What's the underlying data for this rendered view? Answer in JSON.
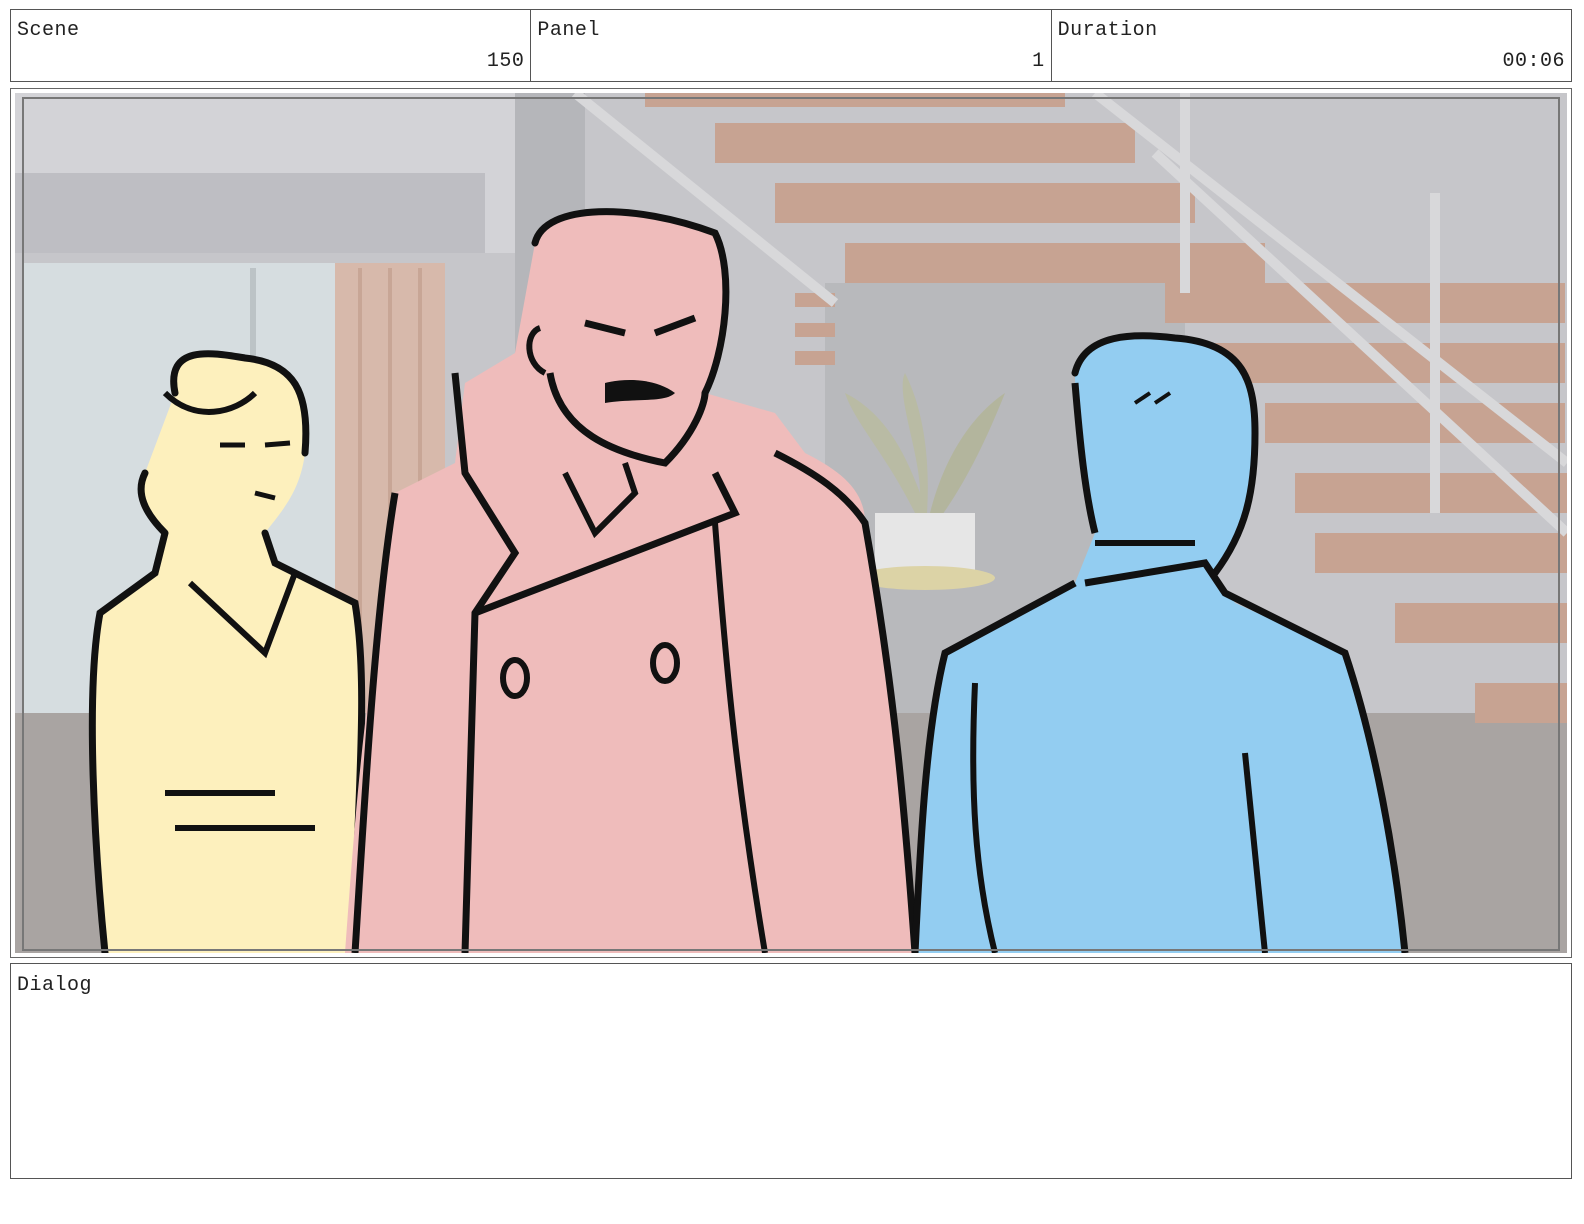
{
  "header": {
    "scene": {
      "label": "Scene",
      "value": "150"
    },
    "panel": {
      "label": "Panel",
      "value": "1"
    },
    "duration": {
      "label": "Duration",
      "value": "00:06"
    }
  },
  "dialog": {
    "label": "Dialog",
    "text": ""
  },
  "colors": {
    "woman": "#fdf0bd",
    "man_coat": "#efbcbb",
    "man_back": "#93cdf1",
    "stairs": "#c9a08e",
    "wall": "#c9c9cc",
    "ink": "#111111"
  }
}
